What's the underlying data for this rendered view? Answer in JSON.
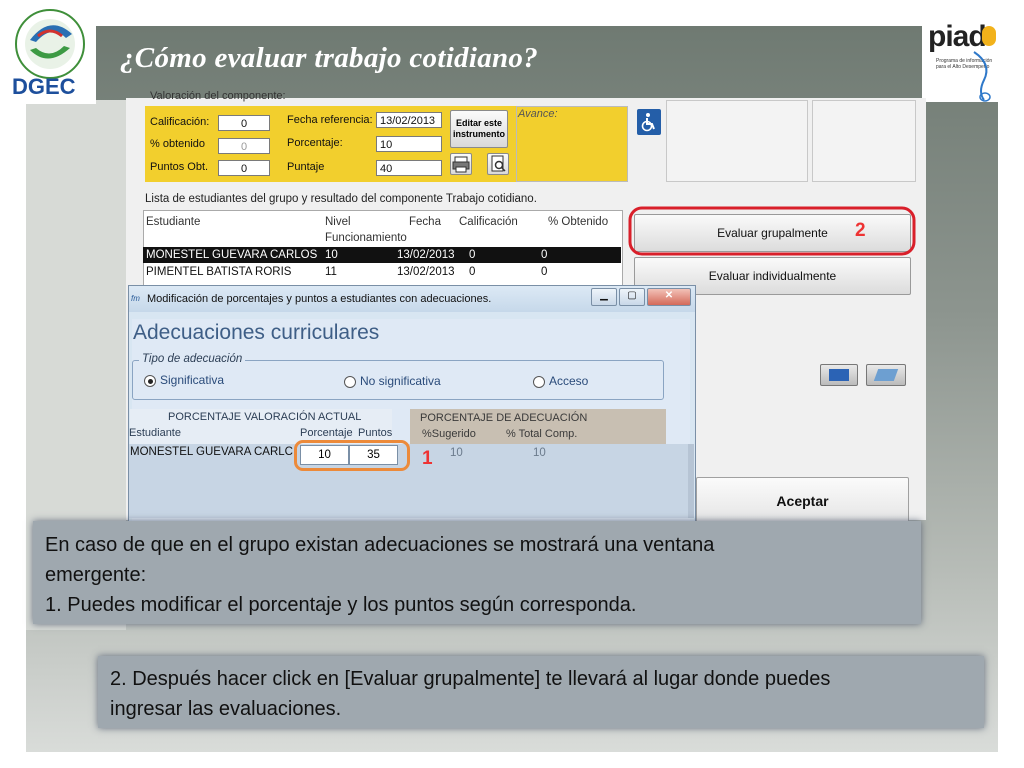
{
  "slide": {
    "title": "¿Cómo evaluar  trabajo cotidiano?",
    "left_logo_text": "DGEC",
    "left_logo_ring": "Dirección de Gestión y Evaluación de la Calidad",
    "right_logo_text": "piad",
    "right_logo_sub": "Programa de información para el Alto Desempeño",
    "note1_line1": "En caso de que en el grupo existan adecuaciones se mostrará una ventana",
    "note1_line2": "emergente:",
    "note1_line3": "1.  Puedes modificar el porcentaje y los puntos según corresponda.",
    "note2_line1": "2. Después hacer click en [Evaluar grupalmente] te llevará al lugar donde puedes",
    "note2_line2": "ingresar las evaluaciones."
  },
  "screenshot": {
    "section_label": "Valoración del componente:",
    "yellow": {
      "calificacion_label": "Calificación:",
      "calificacion_value": "0",
      "obtenido_label": "% obtenido",
      "obtenido_value": "0",
      "puntos_label": "Puntos Obt.",
      "puntos_value": "0",
      "fecha_label": "Fecha referencia:",
      "fecha_value": "13/02/2013",
      "porcentaje_label": "Porcentaje:",
      "porcentaje_value": "10",
      "puntaje_label": "Puntaje",
      "puntaje_value": "40",
      "editar_label_1": "Editar este",
      "editar_label_2": "instrumento"
    },
    "avance_label": "Avance:",
    "list_title": "Lista de estudiantes del grupo y resultado del componente Trabajo cotidiano.",
    "columns": {
      "c1": "Estudiante",
      "c2": "Nivel",
      "c2b": "Funcionamiento",
      "c3": "Fecha",
      "c4": "Calificación",
      "c5": "% Obtenido"
    },
    "rows": [
      {
        "name": "MONESTEL GUEVARA CARLOS",
        "nivel": "10",
        "fecha": "13/02/2013",
        "cal": "0",
        "obt": "0"
      },
      {
        "name": "PIMENTEL BATISTA RORIS",
        "nivel": "11",
        "fecha": "13/02/2013",
        "cal": "0",
        "obt": "0"
      }
    ],
    "btn_grupal": "Evaluar grupalmente",
    "btn_individual": "Evaluar individualmente",
    "btn_aceptar": "Aceptar",
    "badge_2": "2"
  },
  "dialog": {
    "icon_text": "fm",
    "title": "Modificación de porcentajes y puntos a estudiantes con adecuaciones.",
    "heading": "Adecuaciones curriculares",
    "group_legend": "Tipo de adecuación",
    "option_1": "Significativa",
    "option_2": "No significativa",
    "option_3": "Acceso",
    "hdr_actual": "PORCENTAJE VALORACIÓN ACTUAL",
    "hdr_adecuacion": "PORCENTAJE DE ADECUACIÓN",
    "col_estudiante": "Estudiante",
    "col_porcentaje": "Porcentaje",
    "col_puntos": "Puntos",
    "col_sugerido": "%Sugerido",
    "col_total": "% Total Comp.",
    "row_name": "MONESTEL GUEVARA CARLC",
    "row_porcentaje": "10",
    "row_puntos": "35",
    "row_sugerido": "10",
    "row_total": "10",
    "badge_1": "1"
  }
}
